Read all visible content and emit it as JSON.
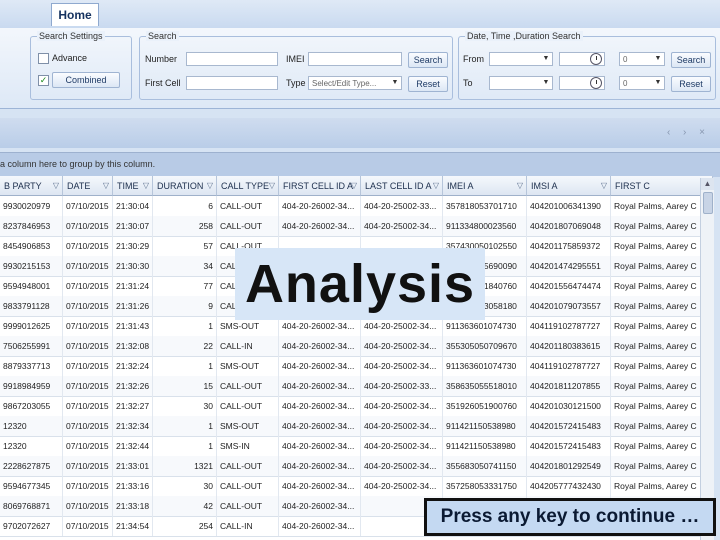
{
  "tabs": {
    "home": "Home"
  },
  "search_settings": {
    "title": "Search Settings",
    "advance_label": "Advance",
    "combined_label": "Combined",
    "advance_checked": false,
    "combined_checked": true
  },
  "search": {
    "title": "Search",
    "number_label": "Number",
    "imei_label": "IMEI",
    "first_cell_label": "First Cell",
    "type_label": "Type",
    "type_placeholder": "Select/Edit Type...",
    "search_button": "Search",
    "reset_button": "Reset"
  },
  "date_search": {
    "title": "Date, Time ,Duration Search",
    "from_label": "From",
    "to_label": "To",
    "from_seconds": "0",
    "to_seconds": "0",
    "search_button": "Search",
    "reset_button": "Reset"
  },
  "group_hint": "a column here to group by this column.",
  "columns": [
    "B PARTY",
    "DATE",
    "TIME",
    "DURATION",
    "CALL TYPE",
    "FIRST CELL ID A",
    "LAST CELL ID A",
    "IMEI A",
    "IMSI A",
    "FIRST C"
  ],
  "rows": [
    [
      "9930020979",
      "07/10/2015",
      "21:30:04",
      "6",
      "CALL-OUT",
      "404-20-26002-34...",
      "404-20-25002-33...",
      "357818053701710",
      "404201006341390",
      "Royal Palms, Aarey C"
    ],
    [
      "8237846953",
      "07/10/2015",
      "21:30:07",
      "258",
      "CALL-OUT",
      "404-20-26002-34...",
      "404-20-25002-34...",
      "911334800023560",
      "404201807069048",
      "Royal Palms, Aarey C"
    ],
    [
      "8454906853",
      "07/10/2015",
      "21:30:29",
      "57",
      "CALL-OUT",
      "",
      "",
      "357430050102550",
      "404201175859372",
      "Royal Palms, Aarey C"
    ],
    [
      "9930215153",
      "07/10/2015",
      "21:30:30",
      "34",
      "CALL-OUT",
      "",
      "",
      "355402055690090",
      "404201474295551",
      "Royal Palms, Aarey C"
    ],
    [
      "9594948001",
      "07/10/2015",
      "21:31:24",
      "77",
      "CALL-OUT",
      "",
      "",
      "354810051840760",
      "404201556474474",
      "Royal Palms, Aarey C"
    ],
    [
      "9833791128",
      "07/10/2015",
      "21:31:26",
      "9",
      "CALL-OUT",
      "",
      "",
      "357420053058180",
      "404201079073557",
      "Royal Palms, Aarey C"
    ],
    [
      "9999012625",
      "07/10/2015",
      "21:31:43",
      "1",
      "SMS-OUT",
      "404-20-26002-34...",
      "404-20-25002-34...",
      "911363601074730",
      "404119102787727",
      "Royal Palms, Aarey C"
    ],
    [
      "7506255991",
      "07/10/2015",
      "21:32:08",
      "22",
      "CALL-IN",
      "404-20-26002-34...",
      "404-20-25002-34...",
      "355305050709670",
      "404201180383615",
      "Royal Palms, Aarey C"
    ],
    [
      "8879337713",
      "07/10/2015",
      "21:32:24",
      "1",
      "SMS-OUT",
      "404-20-26002-34...",
      "404-20-25002-34...",
      "911363601074730",
      "404119102787727",
      "Royal Palms, Aarey C"
    ],
    [
      "9918984959",
      "07/10/2015",
      "21:32:26",
      "15",
      "CALL-OUT",
      "404-20-26002-34...",
      "404-20-25002-33...",
      "358635055518010",
      "404201811207855",
      "Royal Palms, Aarey C"
    ],
    [
      "9867203055",
      "07/10/2015",
      "21:32:27",
      "30",
      "CALL-OUT",
      "404-20-26002-34...",
      "404-20-25002-34...",
      "351926051900760",
      "404201030121500",
      "Royal Palms, Aarey C"
    ],
    [
      "12320",
      "07/10/2015",
      "21:32:34",
      "1",
      "SMS-OUT",
      "404-20-26002-34...",
      "404-20-25002-34...",
      "911421150538980",
      "404201572415483",
      "Royal Palms, Aarey C"
    ],
    [
      "12320",
      "07/10/2015",
      "21:32:44",
      "1",
      "SMS-IN",
      "404-20-26002-34...",
      "404-20-25002-34...",
      "911421150538980",
      "404201572415483",
      "Royal Palms, Aarey C"
    ],
    [
      "2228627875",
      "07/10/2015",
      "21:33:01",
      "1321",
      "CALL-OUT",
      "404-20-26002-34...",
      "404-20-25002-34...",
      "355683050741150",
      "404201801292549",
      "Royal Palms, Aarey C"
    ],
    [
      "9594677345",
      "07/10/2015",
      "21:33:16",
      "30",
      "CALL-OUT",
      "404-20-26002-34...",
      "404-20-25002-34...",
      "357258053331750",
      "404205777432430",
      "Royal Palms, Aarey C"
    ],
    [
      "8069768871",
      "07/10/2015",
      "21:33:18",
      "42",
      "CALL-OUT",
      "404-20-26002-34...",
      "",
      "",
      "",
      ""
    ],
    [
      "9702072627",
      "07/10/2015",
      "21:34:54",
      "254",
      "CALL-IN",
      "404-20-26002-34...",
      "",
      "",
      "",
      ""
    ]
  ],
  "overlay": {
    "analysis": "Analysis",
    "press_key": "Press any key to continue …"
  }
}
